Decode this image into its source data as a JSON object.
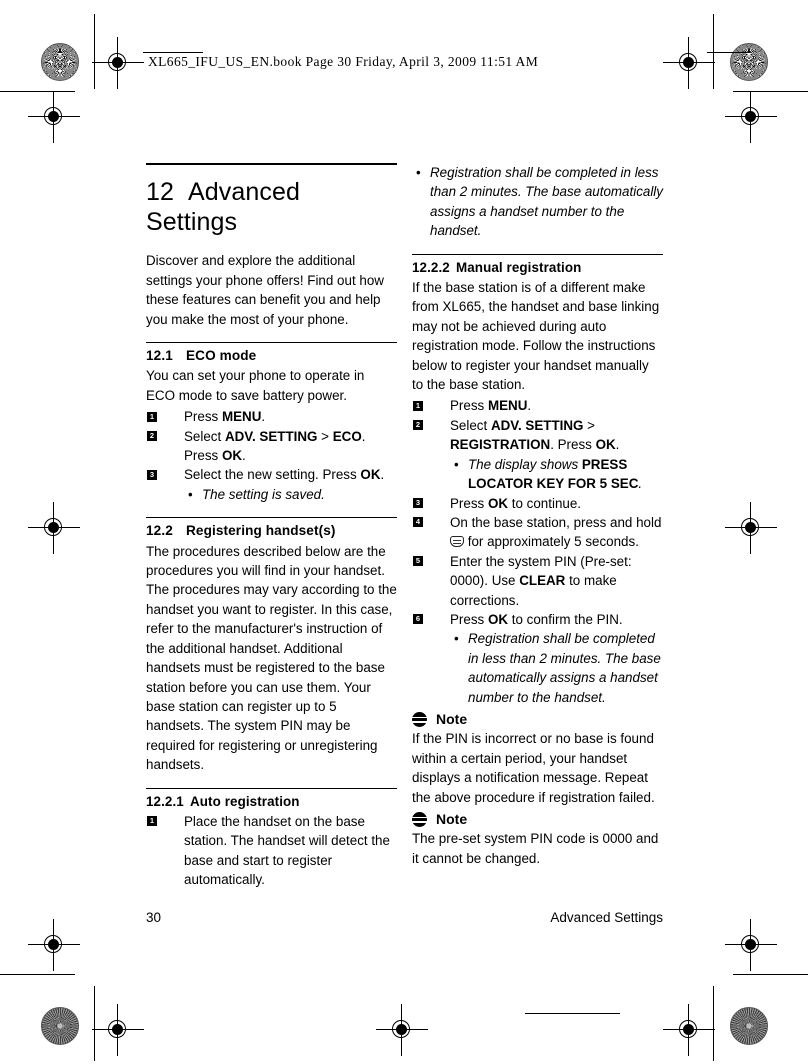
{
  "page_stamp": "XL665_IFU_US_EN.book  Page 30  Friday, April 3, 2009  11:51 AM",
  "chapter": {
    "number": "12",
    "title": "Advanced Settings",
    "intro": "Discover and explore the additional settings your phone offers! Find out how these features can benefit you and help you make the most of your phone."
  },
  "sections": {
    "eco": {
      "number": "12.1",
      "title": "ECO mode",
      "intro": "You can set your phone to operate in ECO mode to save battery power.",
      "steps": [
        {
          "n": "1",
          "text_parts": [
            {
              "t": "Press ",
              "b": false
            },
            {
              "t": "MENU",
              "b": true
            },
            {
              "t": ".",
              "b": false
            }
          ]
        },
        {
          "n": "2",
          "text_parts": [
            {
              "t": "Select ",
              "b": false
            },
            {
              "t": "ADV. SETTING",
              "b": true
            },
            {
              "t": " > ",
              "b": false
            },
            {
              "t": "ECO",
              "b": true
            },
            {
              "t": ". Press ",
              "b": false
            },
            {
              "t": "OK",
              "b": true
            },
            {
              "t": ".",
              "b": false
            }
          ]
        },
        {
          "n": "3",
          "text_parts": [
            {
              "t": "Select the new setting. Press ",
              "b": false
            },
            {
              "t": "OK",
              "b": true
            },
            {
              "t": ".",
              "b": false
            }
          ],
          "subs": [
            {
              "parts": [
                {
                  "t": "The setting is saved.",
                  "b": false
                }
              ]
            }
          ]
        }
      ]
    },
    "registering": {
      "number": "12.2",
      "title": "Registering handset(s)",
      "body": "The procedures described below are the procedures you will find in your handset. The procedures may vary according to the handset you want to register. In this case, refer to the manufacturer's instruction of the additional handset. Additional handsets must be registered to the base station before you can use them. Your base station can register up to 5 handsets. The system PIN may be required for registering or unregistering handsets."
    },
    "auto": {
      "number": "12.2.1",
      "title": "Auto registration",
      "steps": [
        {
          "n": "1",
          "text_parts": [
            {
              "t": "Place the handset on the base station. The handset will detect the base and start to register automatically.",
              "b": false
            }
          ]
        }
      ],
      "continued_subs": [
        {
          "parts": [
            {
              "t": "Registration shall be completed in less than 2 minutes. The base automatically assigns a handset number to the handset.",
              "b": false
            }
          ]
        }
      ]
    },
    "manual": {
      "number": "12.2.2",
      "title": "Manual registration",
      "intro": "If the base station is of a different make from XL665, the handset and base linking may not be achieved during auto registration mode. Follow the instructions below to register your handset manually to the base station.",
      "steps": [
        {
          "n": "1",
          "text_parts": [
            {
              "t": "Press ",
              "b": false
            },
            {
              "t": "MENU",
              "b": true
            },
            {
              "t": ".",
              "b": false
            }
          ]
        },
        {
          "n": "2",
          "text_parts": [
            {
              "t": "Select ",
              "b": false
            },
            {
              "t": "ADV. SETTING",
              "b": true
            },
            {
              "t": " > ",
              "b": false
            },
            {
              "t": "REGISTRATION",
              "b": true
            },
            {
              "t": ". Press ",
              "b": false
            },
            {
              "t": "OK",
              "b": true
            },
            {
              "t": ".",
              "b": false
            }
          ],
          "subs": [
            {
              "parts": [
                {
                  "t": "The display shows ",
                  "b": false
                },
                {
                  "t": "PRESS LOCATOR KEY FOR 5 SEC",
                  "b": true
                },
                {
                  "t": ".",
                  "b": false
                }
              ]
            }
          ]
        },
        {
          "n": "3",
          "text_parts": [
            {
              "t": "Press ",
              "b": false
            },
            {
              "t": "OK",
              "b": true
            },
            {
              "t": " to continue.",
              "b": false
            }
          ]
        },
        {
          "n": "4",
          "text_parts": [
            {
              "t": "On the base station, press and hold ",
              "b": false
            },
            {
              "t": "[locator-key-icon]",
              "b": false,
              "icon": "locator-key-icon"
            },
            {
              "t": " for approximately 5 seconds.",
              "b": false
            }
          ]
        },
        {
          "n": "5",
          "text_parts": [
            {
              "t": "Enter the system PIN (Pre-set: 0000). Use ",
              "b": false
            },
            {
              "t": "CLEAR",
              "b": true
            },
            {
              "t": " to make corrections.",
              "b": false
            }
          ]
        },
        {
          "n": "6",
          "text_parts": [
            {
              "t": "Press ",
              "b": false
            },
            {
              "t": "OK",
              "b": true
            },
            {
              "t": " to confirm the PIN.",
              "b": false
            }
          ],
          "subs": [
            {
              "parts": [
                {
                  "t": "Registration shall be completed in less than 2 minutes. The base automatically assigns a handset number to the handset.",
                  "b": false
                }
              ]
            }
          ]
        }
      ]
    }
  },
  "notes": [
    {
      "label": "Note",
      "text": "If the PIN is incorrect or no base is found within a certain period, your handset displays a notification message. Repeat the above procedure if registration failed."
    },
    {
      "label": "Note",
      "text": "The pre-set system PIN code is 0000 and it cannot be changed."
    }
  ],
  "footer": {
    "page_number": "30",
    "running_title": "Advanced Settings"
  },
  "icons": {
    "note": "note-icon",
    "locator_key": "locator-key-icon",
    "registration_target": "registration-target-icon",
    "color_rosette": "color-rosette-icon"
  }
}
